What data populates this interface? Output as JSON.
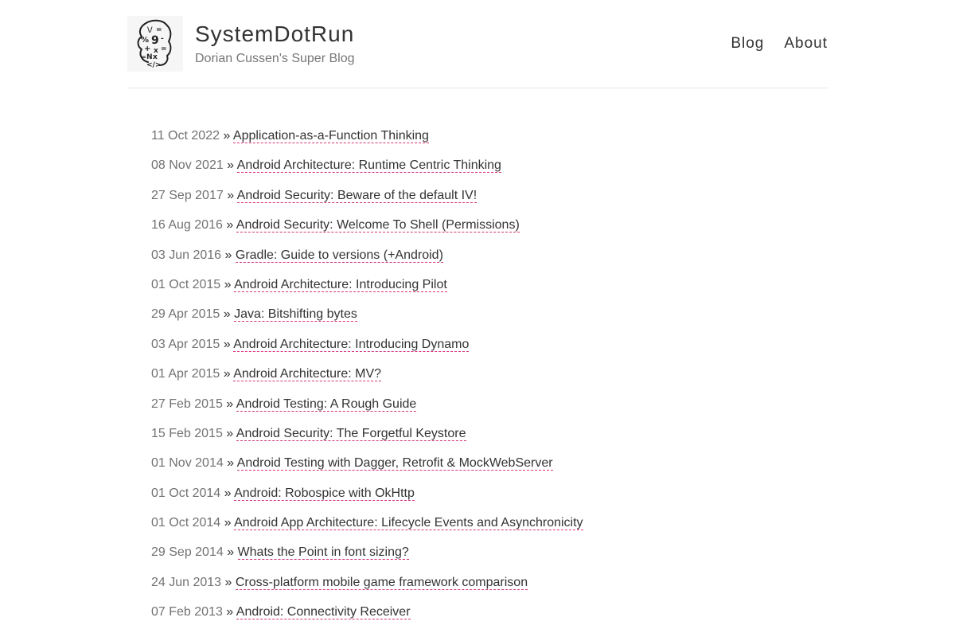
{
  "site": {
    "title": "SystemDotRun",
    "subtitle": "Dorian Cussen's Super Blog",
    "logo_icon": "brain-symbols-icon"
  },
  "nav": {
    "items": [
      "Blog",
      "About"
    ]
  },
  "colors": {
    "link_underline": "#d6347a",
    "text": "#333333",
    "muted": "#727272"
  },
  "posts": [
    {
      "date": "11 Oct 2022",
      "title": "Application-as-a-Function Thinking"
    },
    {
      "date": "08 Nov 2021",
      "title": "Android Architecture: Runtime Centric Thinking"
    },
    {
      "date": "27 Sep 2017",
      "title": "Android Security: Beware of the default IV!"
    },
    {
      "date": "16 Aug 2016",
      "title": "Android Security: Welcome To Shell (Permissions)"
    },
    {
      "date": "03 Jun 2016",
      "title": "Gradle: Guide to versions (+Android)"
    },
    {
      "date": "01 Oct 2015",
      "title": "Android Architecture: Introducing Pilot"
    },
    {
      "date": "29 Apr 2015",
      "title": "Java: Bitshifting bytes"
    },
    {
      "date": "03 Apr 2015",
      "title": "Android Architecture: Introducing Dynamo"
    },
    {
      "date": "01 Apr 2015",
      "title": "Android Architecture: MV?"
    },
    {
      "date": "27 Feb 2015",
      "title": "Android Testing: A Rough Guide"
    },
    {
      "date": "15 Feb 2015",
      "title": "Android Security: The Forgetful Keystore"
    },
    {
      "date": "01 Nov 2014",
      "title": "Android Testing with Dagger, Retrofit & MockWebServer"
    },
    {
      "date": "01 Oct 2014",
      "title": "Android: Robospice with OkHttp"
    },
    {
      "date": "01 Oct 2014",
      "title": "Android App Architecture: Lifecycle Events and Asynchronicity"
    },
    {
      "date": "29 Sep 2014",
      "title": "Whats the Point in font sizing?"
    },
    {
      "date": "24 Jun 2013",
      "title": "Cross-platform mobile game framework comparison"
    },
    {
      "date": "07 Feb 2013",
      "title": "Android: Connectivity Receiver"
    }
  ]
}
